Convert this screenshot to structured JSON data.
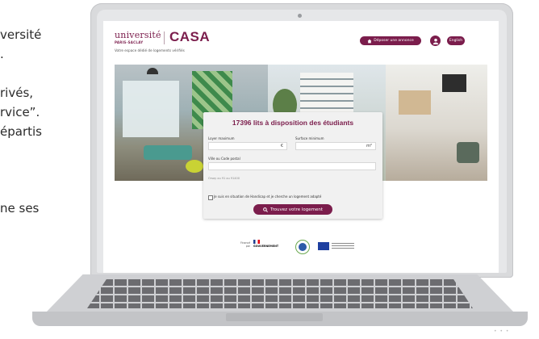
{
  "left_text": {
    "line1": "versité",
    "line2": ".",
    "line3": "rivés,",
    "line4": "rvice”.",
    "line5": "épartis",
    "line6": "ne ses"
  },
  "site": {
    "logo": {
      "university": "université",
      "paris_saclay": "PARIS-SACLAY",
      "casa": "CASA"
    },
    "tagline": "Votre espace dédié de logements vérifiés",
    "deposit_button": "Déposer une annonce",
    "language_button": "English"
  },
  "search": {
    "title": "17396 lits à disposition des étudiants",
    "rent_label": "Loyer maximum",
    "rent_unit": "€",
    "surface_label": "Surface minimum",
    "surface_unit": "m²",
    "city_label": "Ville ou Code postal",
    "city_hint": "Orsay ou 91 ou 91400",
    "handicap_label": "Je suis en situation de Handicap et je cherche un logement adapté",
    "submit_button": "Trouvez votre logement"
  },
  "partners": {
    "financed_by": "Financé par",
    "gov_name": "GOUVERNEMENT"
  },
  "colors": {
    "brand": "#7b1d4c",
    "card_bg": "#f1f1f1"
  },
  "icons": [
    "home-icon",
    "user-icon",
    "search-icon",
    "checkbox-icon",
    "camera-icon"
  ]
}
